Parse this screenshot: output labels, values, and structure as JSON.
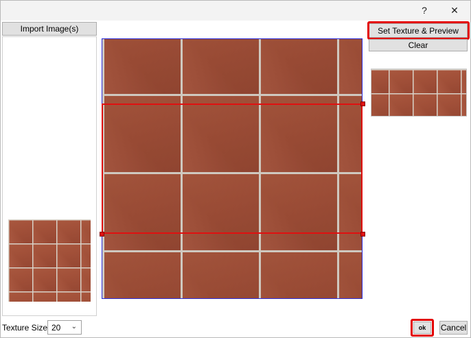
{
  "titlebar": {
    "help_glyph": "?",
    "close_glyph": "✕"
  },
  "left": {
    "import_label": "Import Image(s)"
  },
  "right": {
    "set_texture_label": "Set Texture & Preview",
    "clear_label": "Clear"
  },
  "footer": {
    "texture_size_label": "Texture Size:",
    "texture_size_value": "20",
    "ok_label": "ok",
    "cancel_label": "Cancel"
  },
  "colors": {
    "tile": "#a8553c",
    "grout": "#d8d2c8",
    "selection": "#e01010",
    "canvas_border": "#2b2bd9",
    "highlight": "#e30000"
  }
}
